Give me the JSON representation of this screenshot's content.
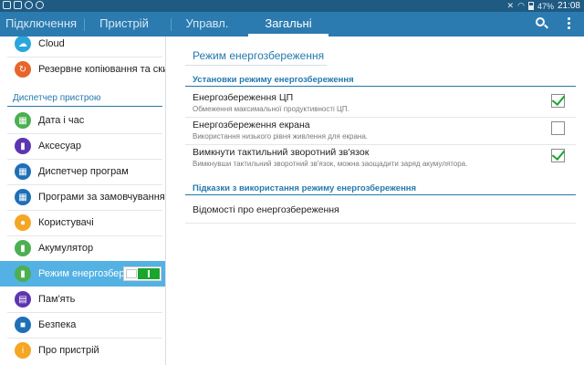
{
  "status_bar": {
    "battery": "47%",
    "time": "21:08",
    "icons": [
      "screenshot-icon",
      "chart-icon",
      "sync-icon",
      "block-icon",
      "wifi-icon",
      "mute-icon",
      "battery-icon"
    ]
  },
  "tabs": [
    {
      "label": "Підключення",
      "active": false
    },
    {
      "label": "Пристрій",
      "active": false
    },
    {
      "label": "Управл.",
      "active": false
    },
    {
      "label": "Загальні",
      "active": true
    }
  ],
  "actions": [
    "search-icon",
    "more-options-icon"
  ],
  "sidebar": {
    "items_top": [
      {
        "label": "Cloud",
        "icon": "cloud-icon",
        "color": "#2aa6dc"
      },
      {
        "label": "Резервне копіювання та ски",
        "icon": "backup-icon",
        "color": "#e8652a"
      }
    ],
    "section_header": "Диспетчер пристрою",
    "items": [
      {
        "label": "Дата і час",
        "icon": "calendar-icon",
        "color": "#4caf50"
      },
      {
        "label": "Аксесуар",
        "icon": "accessory-icon",
        "color": "#5e35b1"
      },
      {
        "label": "Диспетчер програм",
        "icon": "apps-grid-icon",
        "color": "#1e6fb8"
      },
      {
        "label": "Програми за замовчуванням",
        "icon": "default-apps-icon",
        "color": "#1e6fb8"
      },
      {
        "label": "Користувачі",
        "icon": "users-icon",
        "color": "#f5a623"
      },
      {
        "label": "Акумулятор",
        "icon": "battery-icon",
        "color": "#4caf50"
      },
      {
        "label": "Режим енергозбер",
        "icon": "power-saving-icon",
        "color": "#4caf50",
        "selected": true,
        "toggle_on": true
      },
      {
        "label": "Пам'ять",
        "icon": "storage-icon",
        "color": "#5e35b1"
      },
      {
        "label": "Безпека",
        "icon": "lock-icon",
        "color": "#1e6fb8"
      },
      {
        "label": "Про пристрій",
        "icon": "info-icon",
        "color": "#f5a623"
      }
    ]
  },
  "main": {
    "title": "Режим енергозбереження",
    "section1": "Установки режиму енергозбереження",
    "options": [
      {
        "title": "Енергозбереження ЦП",
        "subtitle": "Обмеження максимальної продуктивності ЦП.",
        "checked": true
      },
      {
        "title": "Енергозбереження екрана",
        "subtitle": "Використання низького рівня живлення для екрана.",
        "checked": false
      },
      {
        "title": "Вимкнути тактильний зворотний зв'язок",
        "subtitle": "Вимкнувши тактильний зворотний зв'язок, можна заощадити заряд акумулятора.",
        "checked": true
      }
    ],
    "section2": "Підказки з використання режиму енергозбереження",
    "link": "Відомості про енергозбереження"
  }
}
